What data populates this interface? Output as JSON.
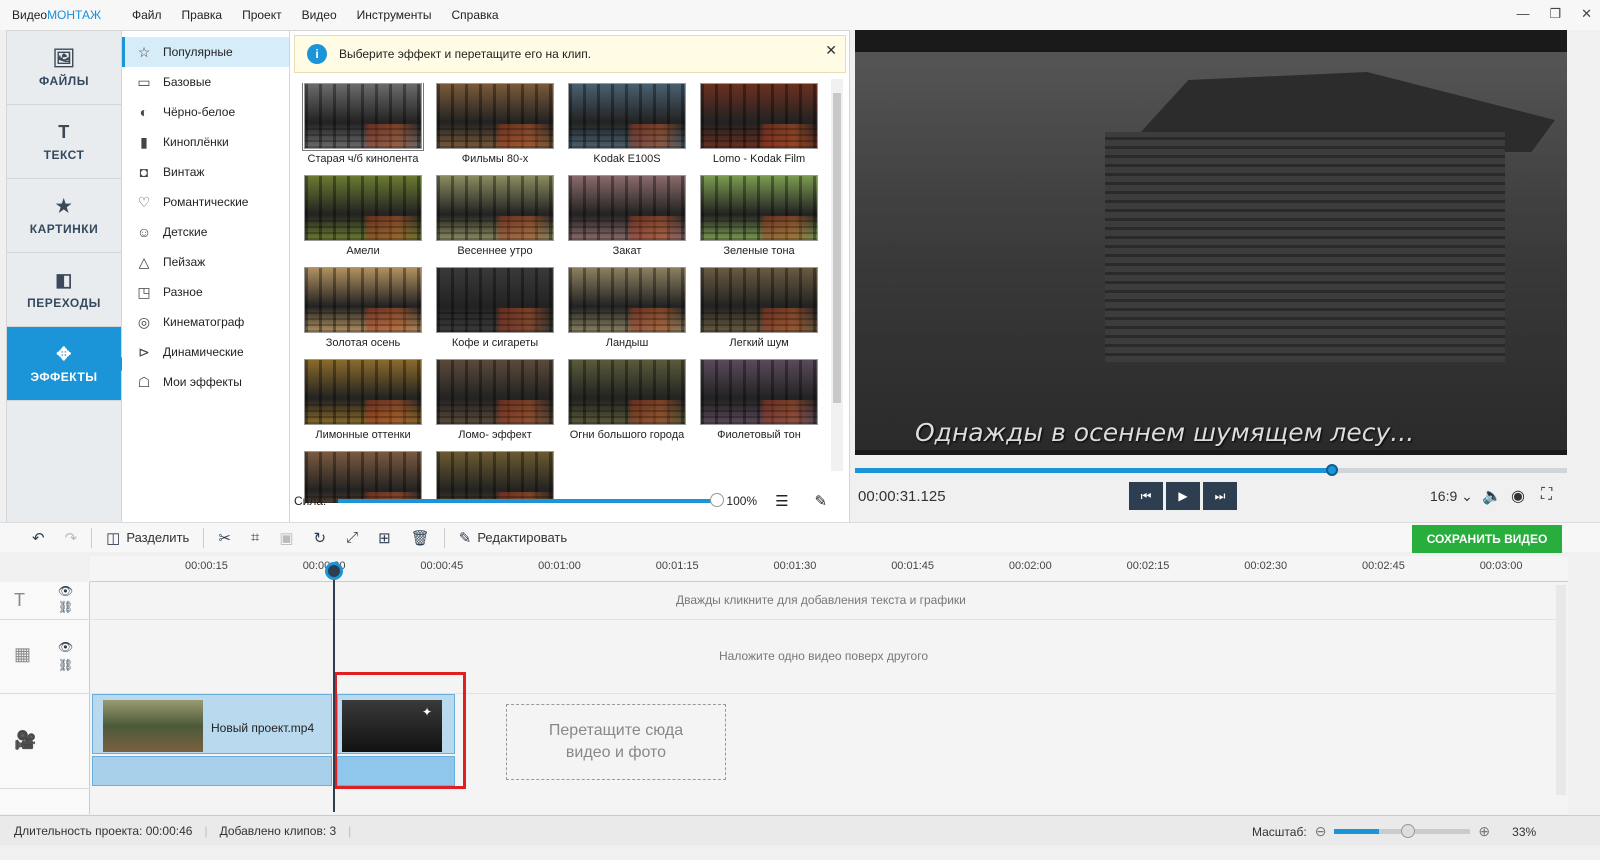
{
  "app": {
    "logo_prefix": "Видео",
    "logo_suffix": "МОНТАЖ"
  },
  "menu": [
    "Файл",
    "Правка",
    "Проект",
    "Видео",
    "Инструменты",
    "Справка"
  ],
  "sidenav": [
    {
      "label": "ФАЙЛЫ",
      "icon": "image-icon"
    },
    {
      "label": "ТЕКСТ",
      "icon": "text-icon"
    },
    {
      "label": "КАРТИНКИ",
      "icon": "star-icon"
    },
    {
      "label": "ПЕРЕХОДЫ",
      "icon": "transitions-icon"
    },
    {
      "label": "ЭФФЕКТЫ",
      "icon": "effects-icon",
      "active": true
    }
  ],
  "categories": [
    {
      "label": "Популярные",
      "icon": "star-outline-icon"
    },
    {
      "label": "Базовые",
      "icon": "basic-icon"
    },
    {
      "label": "Чёрно-белое",
      "icon": "bw-icon"
    },
    {
      "label": "Киноплёнки",
      "icon": "film-icon"
    },
    {
      "label": "Винтаж",
      "icon": "camera-icon"
    },
    {
      "label": "Романтические",
      "icon": "heart-icon"
    },
    {
      "label": "Детские",
      "icon": "kids-icon"
    },
    {
      "label": "Пейзаж",
      "icon": "mountain-icon"
    },
    {
      "label": "Разное",
      "icon": "misc-icon"
    },
    {
      "label": "Кинематограф",
      "icon": "cinema-icon"
    },
    {
      "label": "Динамические",
      "icon": "play-circle-icon"
    },
    {
      "label": "Мои эффекты",
      "icon": "user-icon"
    }
  ],
  "info_text": "Выберите эффект и перетащите его на клип.",
  "effects": [
    {
      "label": "Старая ч/б кинолента",
      "tint": "#6b6b6b"
    },
    {
      "label": "Фильмы 80-х",
      "tint": "#7a5a3a"
    },
    {
      "label": "Kodak E100S",
      "tint": "#4a6070"
    },
    {
      "label": "Lomo - Kodak Film",
      "tint": "#6a3020"
    },
    {
      "label": "Амели",
      "tint": "#6a7a30"
    },
    {
      "label": "Весеннее утро",
      "tint": "#8a8a60"
    },
    {
      "label": "Закат",
      "tint": "#8a6a6a"
    },
    {
      "label": "Зеленые тона",
      "tint": "#7a9a50"
    },
    {
      "label": "Золотая осень",
      "tint": "#b09060"
    },
    {
      "label": "Кофе и сигареты",
      "tint": "#3a3a3a"
    },
    {
      "label": "Ландыш",
      "tint": "#8a8060"
    },
    {
      "label": "Легкий шум",
      "tint": "#6a5a40"
    },
    {
      "label": "Лимонные оттенки",
      "tint": "#8a6a2a"
    },
    {
      "label": "Ломо- эффект",
      "tint": "#5a4a3a"
    },
    {
      "label": "Огни большого города",
      "tint": "#5a5a3a"
    },
    {
      "label": "Фиолетовый тон",
      "tint": "#5a4a5a"
    },
    {
      "label": "",
      "tint": "#7a5a40"
    },
    {
      "label": "",
      "tint": "#6a5a30"
    }
  ],
  "strength": {
    "label": "Сила:",
    "percent": "100%",
    "value": 1.0
  },
  "preview": {
    "subtitle": "Однажды в осеннем шумящем лесу...",
    "progress": 0.67
  },
  "player": {
    "time": "00:00:31.125",
    "ratio": "16:9"
  },
  "toolbar": {
    "split": "Разделить",
    "edit": "Редактировать",
    "save": "СОХРАНИТЬ ВИДЕО"
  },
  "ruler": [
    "00:00:15",
    "00:00:30",
    "00:00:45",
    "00:01:00",
    "00:01:15",
    "00:01:30",
    "00:01:45",
    "00:02:00",
    "00:02:15",
    "00:02:30",
    "00:02:45",
    "00:03:00"
  ],
  "timeline": {
    "text_hint": "Дважды кликните для добавления текста и графики",
    "overlay_hint": "Наложите одно видео поверх другого",
    "clip1_name": "Новый проект.mp4",
    "dropzone": "Перетащите сюда\nвидео и фото"
  },
  "status": {
    "duration": "Длительность проекта:  00:00:46",
    "clips": "Добавлено клипов: 3",
    "zoom_label": "Масштаб:",
    "zoom_value": "33%",
    "zoom_level": 0.33
  }
}
